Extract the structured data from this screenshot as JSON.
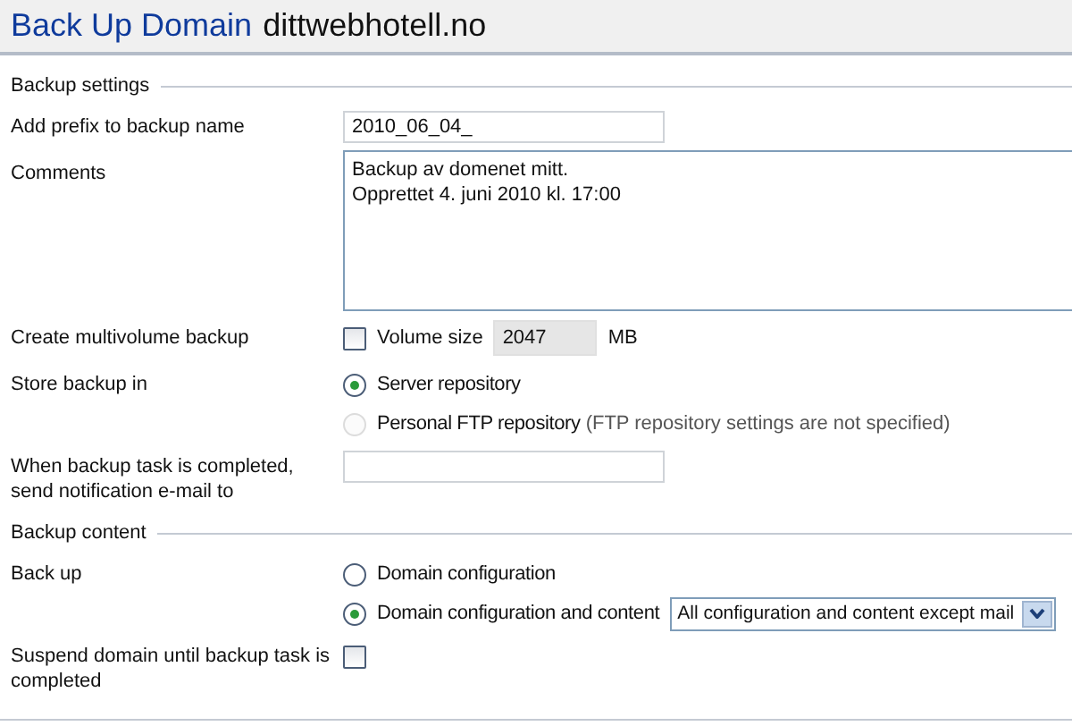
{
  "page_title": {
    "action": "Back Up Domain",
    "domain": "dittwebhotell.no"
  },
  "sections": [
    {
      "title": "Backup settings",
      "rows": [
        {
          "kind": "text",
          "label": "Add prefix to backup name",
          "value": "2010_06_04_"
        },
        {
          "kind": "textarea",
          "label": "Comments",
          "value": "Backup av domenet mitt.\nOpprettet 4. juni 2010 kl. 17:00"
        },
        {
          "kind": "multivolume",
          "label": "Create multivolume backup",
          "checked": false,
          "option": "Volume size",
          "value": "2047",
          "disabled": true,
          "unit": "MB"
        },
        {
          "kind": "radios",
          "label": "Store backup in",
          "options": [
            {
              "label": "Server repository",
              "selected": true,
              "disabled": false
            },
            {
              "label": "Personal FTP repository",
              "note": "(FTP repository settings are not specified)",
              "selected": false,
              "disabled": true
            }
          ]
        },
        {
          "kind": "text",
          "label": "When backup task is completed, send notification e-mail to"
        }
      ]
    },
    {
      "title": "Backup content",
      "rows": [
        {
          "kind": "radios",
          "label": "Back up",
          "options": [
            {
              "label": "Domain configuration",
              "selected": false,
              "disabled": false
            },
            {
              "label": "Domain configuration and content",
              "selected": true,
              "disabled": false,
              "select": "All configuration and content except mail"
            }
          ]
        },
        {
          "kind": "checkbox",
          "label": "Suspend domain until backup task is completed",
          "checked": false
        }
      ]
    }
  ]
}
